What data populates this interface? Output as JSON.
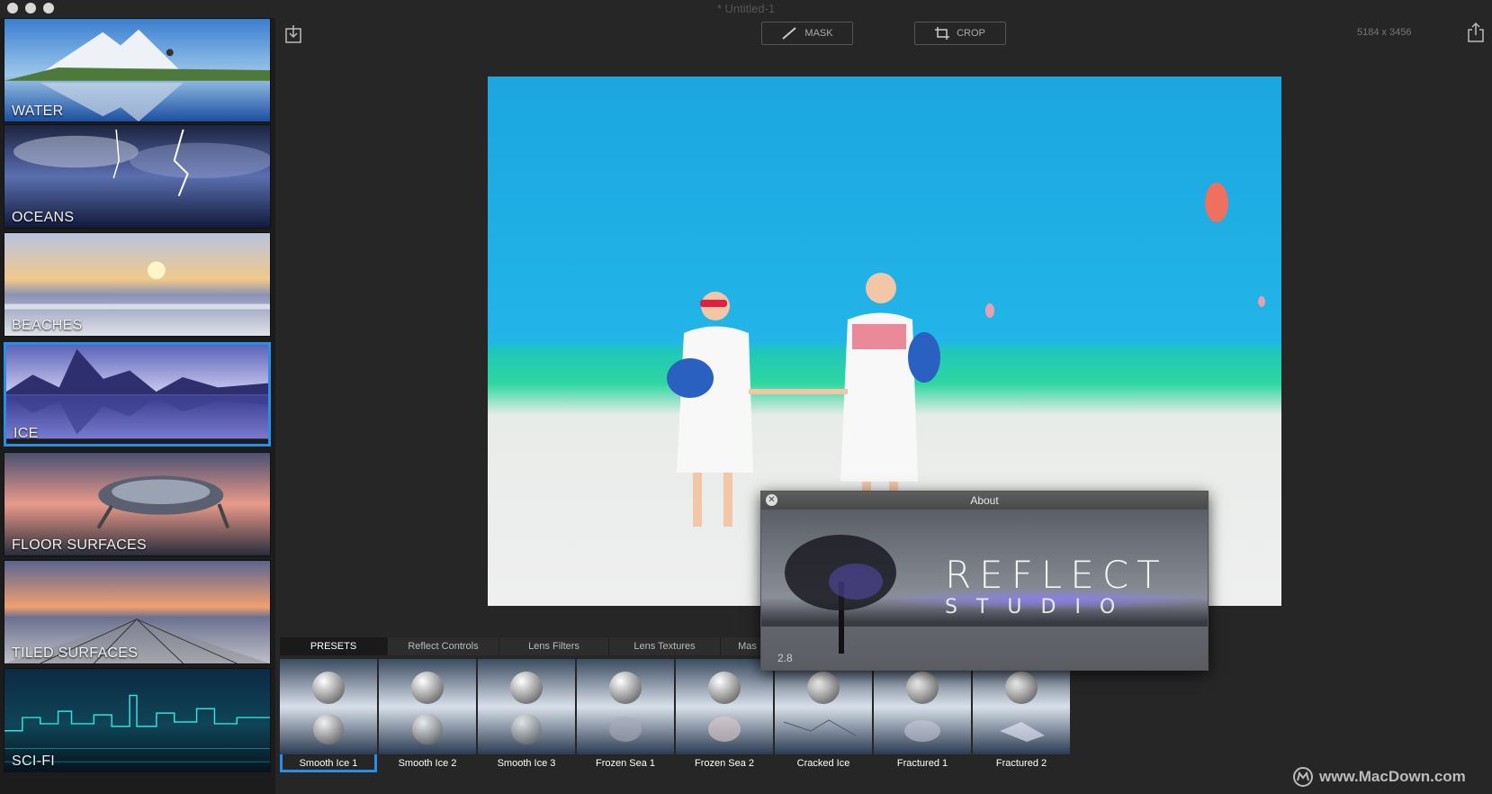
{
  "window": {
    "title": "* Untitled-1"
  },
  "sidebar": {
    "items": [
      {
        "label": "WATER"
      },
      {
        "label": "OCEANS"
      },
      {
        "label": "BEACHES"
      },
      {
        "label": "ICE",
        "selected": true
      },
      {
        "label": "FLOOR SURFACES"
      },
      {
        "label": "TILED SURFACES"
      },
      {
        "label": "SCI-FI"
      }
    ]
  },
  "toolbar": {
    "import_icon": "import-icon",
    "mask_label": "MASK",
    "crop_label": "CROP",
    "image_size": "5184 x 3456",
    "share_icon": "share-icon"
  },
  "tabs": [
    {
      "label": "PRESETS",
      "active": true
    },
    {
      "label": "Reflect Controls"
    },
    {
      "label": "Lens Filters"
    },
    {
      "label": "Lens Textures"
    },
    {
      "label": "Mas"
    }
  ],
  "presets": [
    {
      "label": "Smooth Ice 1",
      "selected": true
    },
    {
      "label": "Smooth Ice 2"
    },
    {
      "label": "Smooth Ice 3"
    },
    {
      "label": "Frozen Sea 1"
    },
    {
      "label": "Frozen Sea 2"
    },
    {
      "label": "Cracked Ice"
    },
    {
      "label": "Fractured 1"
    },
    {
      "label": "Fractured 2"
    }
  ],
  "about": {
    "title": "About",
    "logo_line1": "REFLECT",
    "logo_line2": "STUDIO",
    "version": "2.8"
  },
  "watermark": "www.MacDown.com",
  "colors": {
    "accent": "#2a8ee8",
    "background": "#262626"
  }
}
